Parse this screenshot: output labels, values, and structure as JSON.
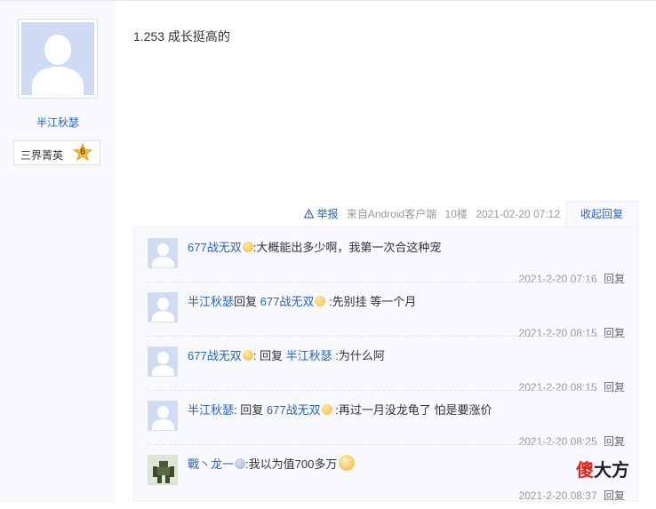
{
  "author": {
    "username": "半江秋瑟",
    "badge_label": "三界菁英",
    "badge_level": "6"
  },
  "post": {
    "text": "1.253 成长挺高的",
    "report_label": "举报",
    "client": "来自Android客户端",
    "floor": "10楼",
    "time": "2021-02-20 07:12",
    "collapse_label": "收起回复"
  },
  "replies": [
    {
      "name": "677战无双",
      "reply_word": "",
      "target": "",
      "text": ":大概能出多少啊，我第一次合这种宠",
      "time": "2021-2-20 07:16",
      "reply_label": "回复"
    },
    {
      "name": "半江秋瑟",
      "reply_word": "回复",
      "target": "677战无双",
      "text": ":先别挂 等一个月",
      "time": "2021-2-20 08:15",
      "reply_label": "回复"
    },
    {
      "name": "677战无双",
      "reply_word": "回复",
      "target": "半江秋瑟",
      "text": ":为什么阿",
      "time": "2021-2-20 08:15",
      "reply_label": "回复"
    },
    {
      "name": "半江秋瑟",
      "reply_word": "回复",
      "target": "677战无双",
      "text": ":再过一月没龙龟了 怕是要涨价",
      "time": "2021-2-20 08:25",
      "reply_label": "回复"
    },
    {
      "name": "戰丶龙一",
      "reply_word": "",
      "target": "",
      "text": ":我以为值700多万",
      "time": "2021-2-20 08:37",
      "reply_label": "回复"
    }
  ],
  "watermark": {
    "red": "傻",
    "black": "大方"
  }
}
